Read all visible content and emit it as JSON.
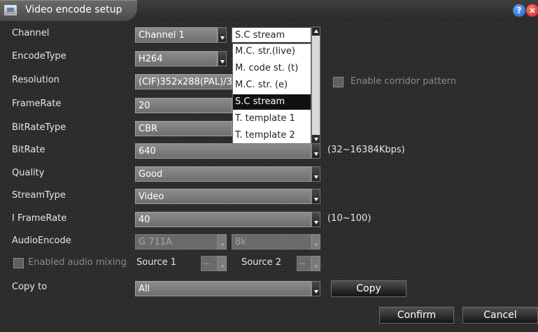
{
  "window": {
    "title": "Video encode setup"
  },
  "fields": {
    "channel": {
      "label": "Channel",
      "value": "Channel 1",
      "stream": "S.C stream"
    },
    "encode_type": {
      "label": "EncodeType",
      "value": "H264"
    },
    "resolution": {
      "label": "Resolution",
      "value": "(CIF)352x288(PAL)/3"
    },
    "frame_rate": {
      "label": "FrameRate",
      "value": "20"
    },
    "bitrate_type": {
      "label": "BitRateType",
      "value": "CBR"
    },
    "bitrate": {
      "label": "BitRate",
      "value": "640",
      "hint": "(32~16384Kbps)"
    },
    "quality": {
      "label": "Quality",
      "value": "Good"
    },
    "stream_type": {
      "label": "StreamType",
      "value": "Video"
    },
    "iframe_rate": {
      "label": "I FrameRate",
      "value": "40",
      "hint": "(10~100)"
    },
    "audio_encode": {
      "label": "AudioEncode",
      "value": "G.711A",
      "rate": "8k"
    },
    "audio_mixing": {
      "label": "Enabled audio mixing",
      "source1_label": "Source 1",
      "source1_value": "--",
      "source2_label": "Source 2",
      "source2_value": "--"
    },
    "copy_to": {
      "label": "Copy to",
      "value": "All"
    }
  },
  "corridor": {
    "label": "Enable corridor pattern"
  },
  "stream_dropdown": {
    "items": [
      "M.C. str.(live)",
      "M. code st. (t)",
      "M.C. str. (e)",
      "S.C stream",
      "T. template 1",
      "T. template 2"
    ],
    "selected": "S.C stream"
  },
  "buttons": {
    "copy": "Copy",
    "confirm": "Confirm",
    "cancel": "Cancel"
  },
  "icons": {
    "help": "help-icon",
    "close": "close-icon"
  },
  "colors": {
    "background": "#2b2b2b",
    "selected_item": "#111111",
    "close": "#c81f1f",
    "help": "#1f5fc8"
  }
}
